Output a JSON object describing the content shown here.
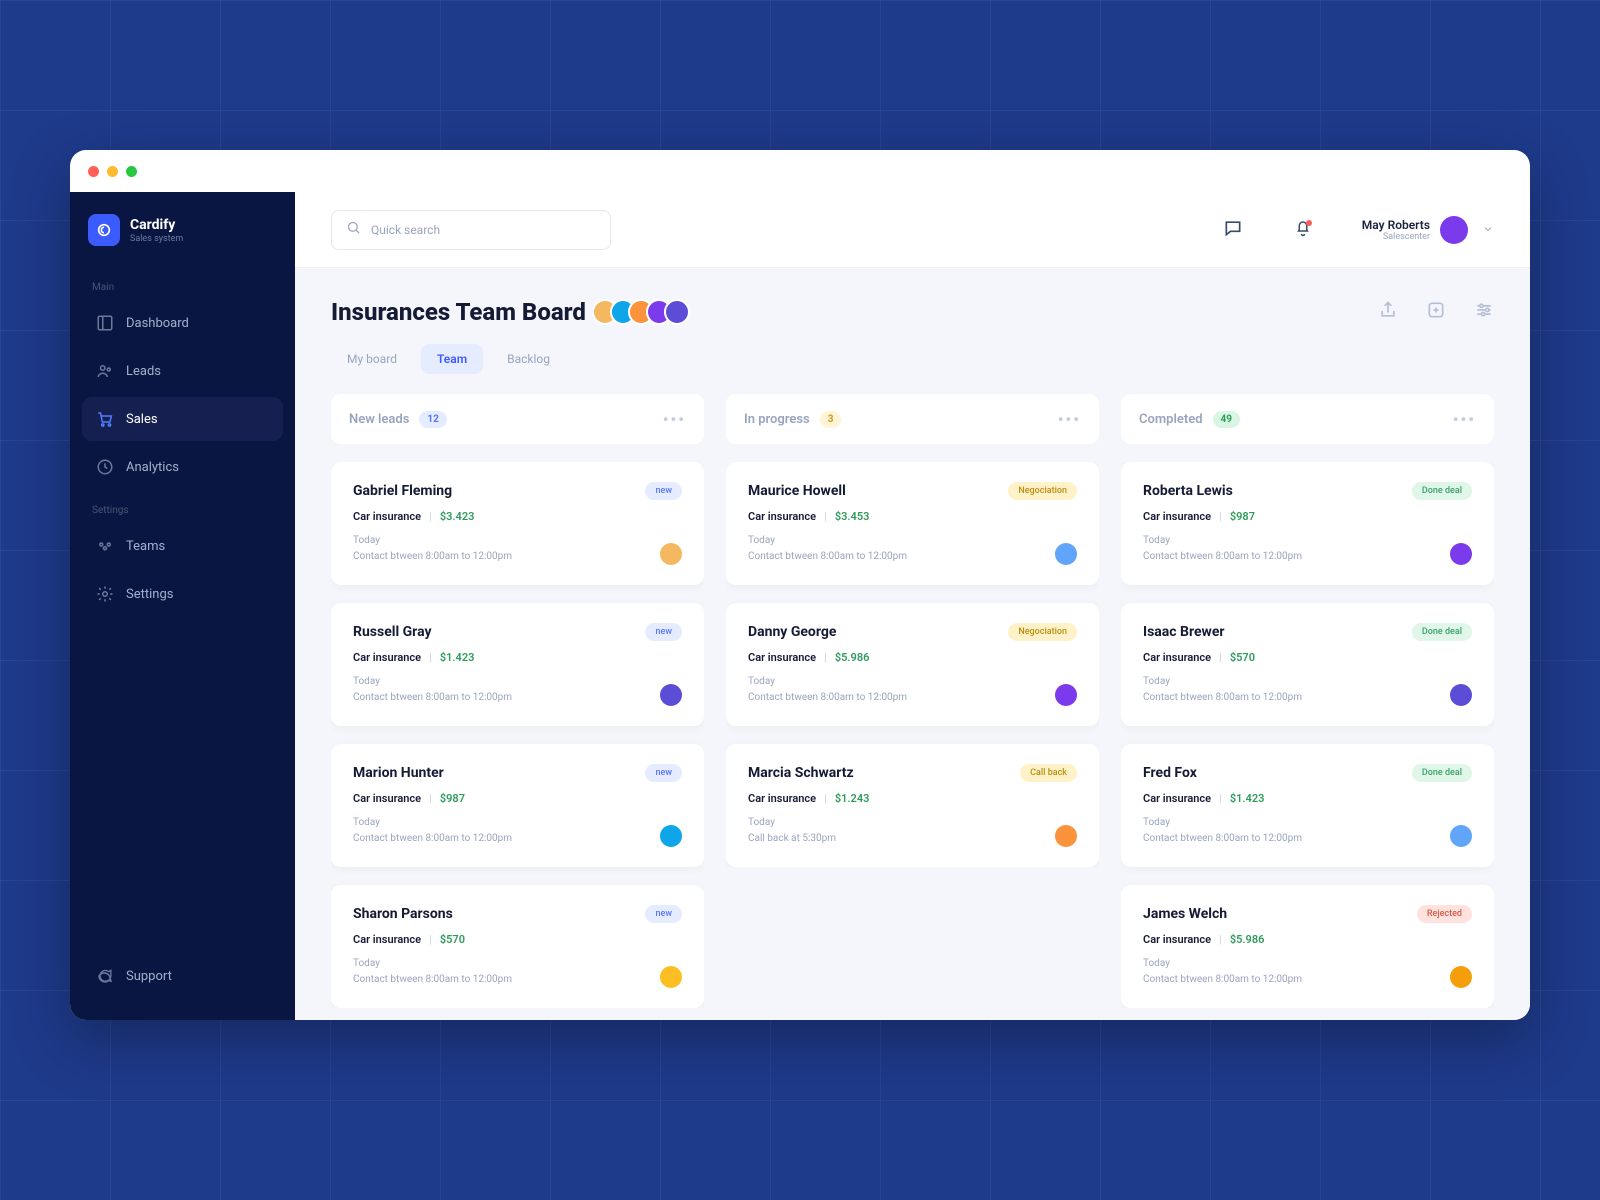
{
  "brand": {
    "name": "Cardify",
    "subtitle": "Sales system"
  },
  "sidebar": {
    "sections": {
      "main": "Main",
      "settings": "Settings"
    },
    "items": {
      "dashboard": "Dashboard",
      "leads": "Leads",
      "sales": "Sales",
      "analytics": "Analytics",
      "teams": "Teams",
      "settings": "Settings",
      "support": "Support"
    }
  },
  "header": {
    "search_placeholder": "Quick search",
    "user": {
      "name": "May Roberts",
      "role": "Salescenter"
    }
  },
  "page": {
    "title": "Insurances Team Board",
    "tabs": {
      "myboard": "My board",
      "team": "Team",
      "backlog": "Backlog"
    }
  },
  "columns": [
    {
      "title": "New leads",
      "count": "12",
      "pillClass": "pill-blue",
      "cards": [
        {
          "name": "Gabriel Fleming",
          "tag": "new",
          "tagClass": "tag-blue",
          "type": "Car insurance",
          "amount": "$3.423",
          "day": "Today",
          "contact": "Contact btween 8:00am to 12:00pm",
          "avatar": "av-a"
        },
        {
          "name": "Russell Gray",
          "tag": "new",
          "tagClass": "tag-blue",
          "type": "Car insurance",
          "amount": "$1.423",
          "day": "Today",
          "contact": "Contact btween 8:00am to 12:00pm",
          "avatar": "av-b"
        },
        {
          "name": "Marion Hunter",
          "tag": "new",
          "tagClass": "tag-blue",
          "type": "Car insurance",
          "amount": "$987",
          "day": "Today",
          "contact": "Contact btween 8:00am to 12:00pm",
          "avatar": "av-c"
        },
        {
          "name": "Sharon Parsons",
          "tag": "new",
          "tagClass": "tag-blue",
          "type": "Car insurance",
          "amount": "$570",
          "day": "Today",
          "contact": "Contact btween 8:00am to 12:00pm",
          "avatar": "av-f"
        }
      ]
    },
    {
      "title": "In progress",
      "count": "3",
      "pillClass": "pill-yellow",
      "cards": [
        {
          "name": "Maurice Howell",
          "tag": "Negociation",
          "tagClass": "tag-yellow",
          "type": "Car insurance",
          "amount": "$3.453",
          "day": "Today",
          "contact": "Contact btween 8:00am to 12:00pm",
          "avatar": "av-g"
        },
        {
          "name": "Danny George",
          "tag": "Negociation",
          "tagClass": "tag-yellow",
          "type": "Car insurance",
          "amount": "$5.986",
          "day": "Today",
          "contact": "Contact btween 8:00am to 12:00pm",
          "avatar": "av-e"
        },
        {
          "name": "Marcia Schwartz",
          "tag": "Call back",
          "tagClass": "tag-yellow",
          "type": "Car insurance",
          "amount": "$1.243",
          "day": "Today",
          "contact": "Call back at 5:30pm",
          "avatar": "av-d"
        }
      ]
    },
    {
      "title": "Completed",
      "count": "49",
      "pillClass": "pill-green",
      "cards": [
        {
          "name": "Roberta Lewis",
          "tag": "Done deal",
          "tagClass": "tag-green",
          "type": "Car insurance",
          "amount": "$987",
          "day": "Today",
          "contact": "Contact btween 8:00am to 12:00pm",
          "avatar": "av-e"
        },
        {
          "name": "Isaac Brewer",
          "tag": "Done deal",
          "tagClass": "tag-green",
          "type": "Car insurance",
          "amount": "$570",
          "day": "Today",
          "contact": "Contact btween 8:00am to 12:00pm",
          "avatar": "av-b"
        },
        {
          "name": "Fred Fox",
          "tag": "Done deal",
          "tagClass": "tag-green",
          "type": "Car insurance",
          "amount": "$1.423",
          "day": "Today",
          "contact": "Contact btween 8:00am to 12:00pm",
          "avatar": "av-g"
        },
        {
          "name": "James Welch",
          "tag": "Rejected",
          "tagClass": "tag-red",
          "type": "Car insurance",
          "amount": "$5.986",
          "day": "Today",
          "contact": "Contact btween 8:00am to 12:00pm",
          "avatar": "av-h"
        }
      ]
    }
  ]
}
